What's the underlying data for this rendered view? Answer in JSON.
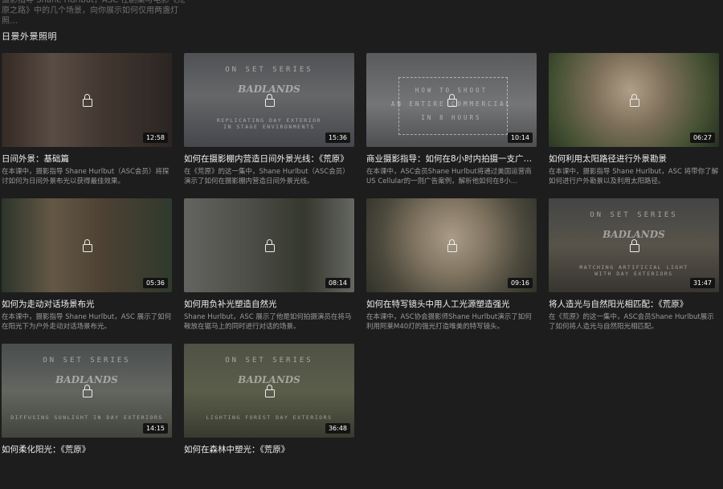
{
  "intro_text": "摄影指导 Shane Hurlbut，ASC 在剧集与电影《荒原之路》中的几个场景，向你展示如何仅用两盏灯照…",
  "section": {
    "title": "日景外景照明"
  },
  "cards": [
    {
      "title": "日间外景：基础篇",
      "description": "在本课中，摄影指导 Shane Hurlbut（ASC会员）将探讨如何为日间外景布光以获得最佳效果。",
      "duration": "12:58"
    },
    {
      "title": "如何在摄影棚内营造日间外景光线：《荒原》",
      "description": "在《荒原》的这一集中，Shane Hurlbut（ASC会员）演示了如何在摄影棚内营造日间外景光线。",
      "duration": "15:36",
      "poster_top": "ON SET SERIES",
      "poster_logo": "BADLANDS",
      "poster_bottom": "REPLICATING DAY EXTERIOR\nIN STAGE ENVIRONMENTS"
    },
    {
      "title": "商业摄影指导：如何在8小时内拍摄一支广…",
      "description": "在本课中，ASC会员Shane Hurlbut将通过美国运营商US Cellular的一则广告案例，解析他如何在8小…",
      "duration": "10:14",
      "poster_top": "HOW TO SHOOT\nAN ENTIRE COMMERCIAL\nIN 8 HOURS"
    },
    {
      "title": "如何利用太阳路径进行外景勘景",
      "description": "在本课中，摄影指导 Shane Hurlbut，ASC 将带你了解如何进行户外勘景以及利用太阳路径。",
      "duration": "06:27"
    },
    {
      "title": "如何为走动对话场景布光",
      "description": "在本课中，摄影指导 Shane Hurlbut，ASC 展示了如何在阳光下为户外走动对话场景布光。",
      "duration": "05:36"
    },
    {
      "title": "如何用负补光塑造自然光",
      "description": "Shane Hurlbut，ASC 展示了他是如何拍摄演员在将马鞍放在锯马上的同时进行对话的场景。",
      "duration": "08:14"
    },
    {
      "title": "如何在特写镜头中用人工光源塑造强光",
      "description": "在本课中，ASC协会摄影师Shane Hurlbut演示了如何利用阿莱M40灯的强光打造唯美的特写镜头。",
      "duration": "09:16"
    },
    {
      "title": "将人造光与自然阳光相匹配：《荒原》",
      "description": "在《荒原》的这一集中，ASC会员Shane Hurlbut展示了如何将人造光与自然阳光相匹配。",
      "duration": "31:47",
      "poster_top": "ON SET SERIES",
      "poster_logo": "BADLANDS",
      "poster_bottom": "MATCHING ARTIFICIAL LIGHT\nWITH DAY EXTERIORS"
    },
    {
      "title": "如何柔化阳光：《荒原》",
      "description": "",
      "duration": "14:15",
      "poster_top": "ON SET SERIES",
      "poster_logo": "BADLANDS",
      "poster_bottom": "DIFFUSING SUNLIGHT IN DAY EXTERIORS"
    },
    {
      "title": "如何在森林中塑光：《荒原》",
      "description": "",
      "duration": "36:48",
      "poster_top": "ON SET SERIES",
      "poster_logo": "BADLANDS",
      "poster_bottom": "LIGHTING FOREST DAY EXTERIORS"
    }
  ],
  "icons": {
    "lock": "lock-icon"
  },
  "colors": {
    "background": "#1d1d1d",
    "title_text": "#f0f0f0",
    "desc_text": "#9a9a9a",
    "badge_bg": "#0f0f0f"
  }
}
